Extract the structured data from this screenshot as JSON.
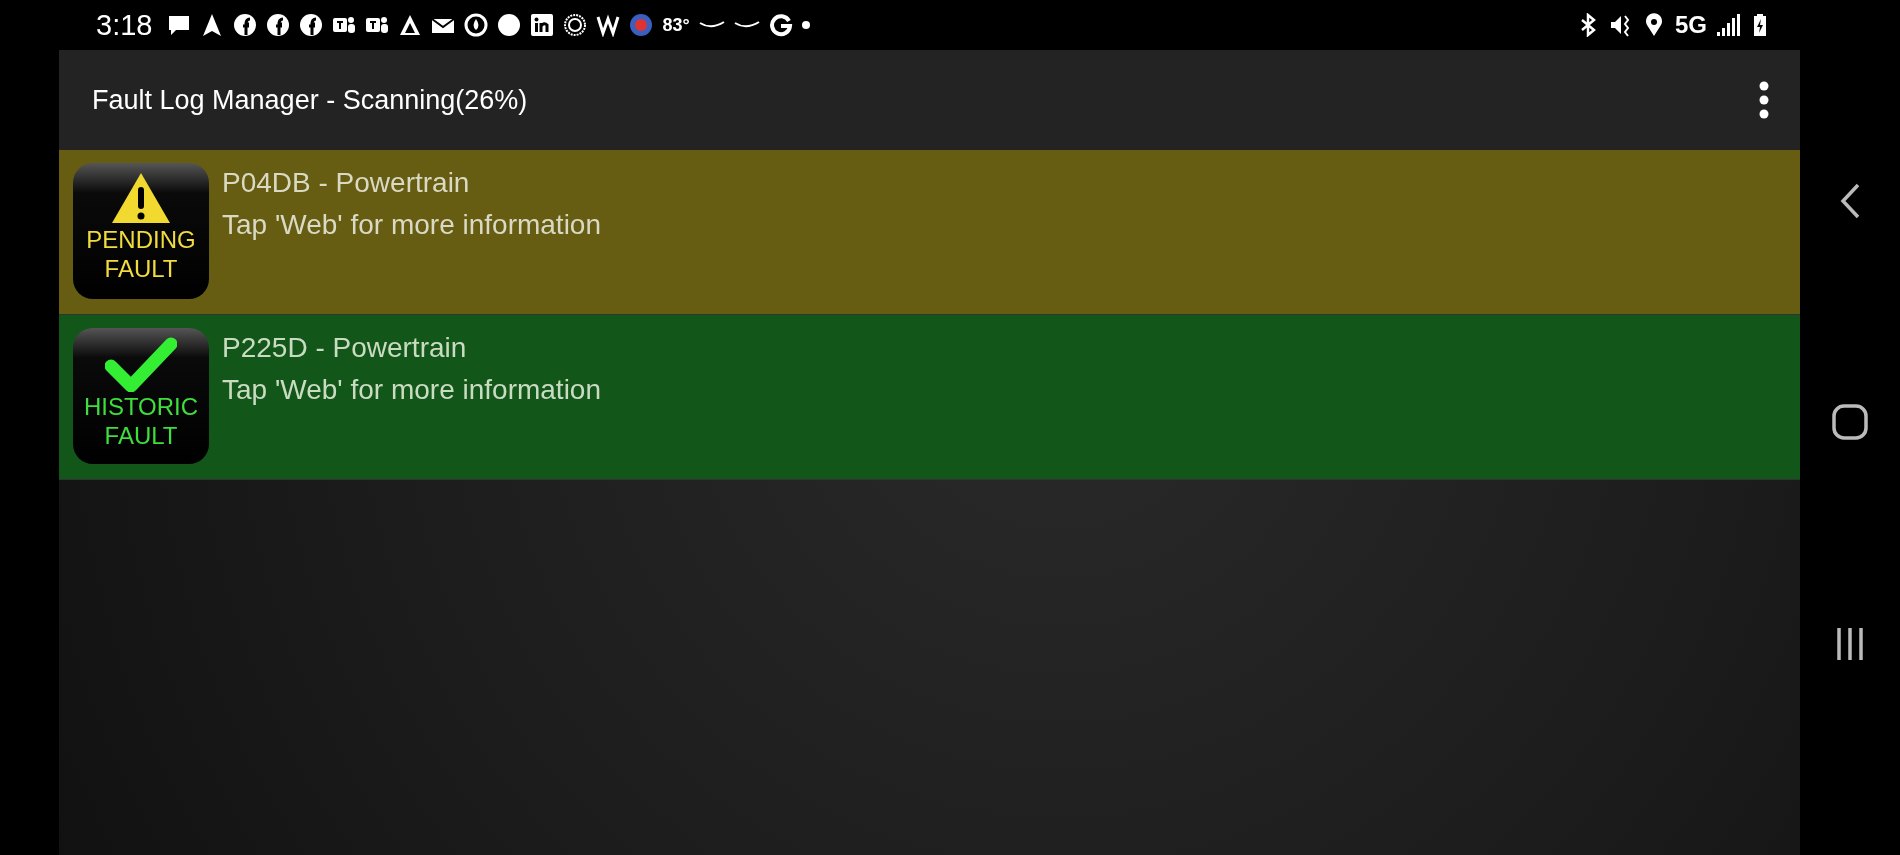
{
  "status_bar": {
    "time": "3:18",
    "temperature": "83°",
    "network": "5G"
  },
  "app_bar": {
    "title": "Fault Log Manager - Scanning(26%)"
  },
  "faults": [
    {
      "kind": "pending",
      "badge_lines": [
        "PENDING",
        "FAULT"
      ],
      "title": "P04DB - Powertrain",
      "subtitle": "Tap 'Web' for more information"
    },
    {
      "kind": "historic",
      "badge_lines": [
        "HISTORIC",
        "FAULT"
      ],
      "title": "P225D - Powertrain",
      "subtitle": "Tap 'Web' for more information"
    }
  ]
}
